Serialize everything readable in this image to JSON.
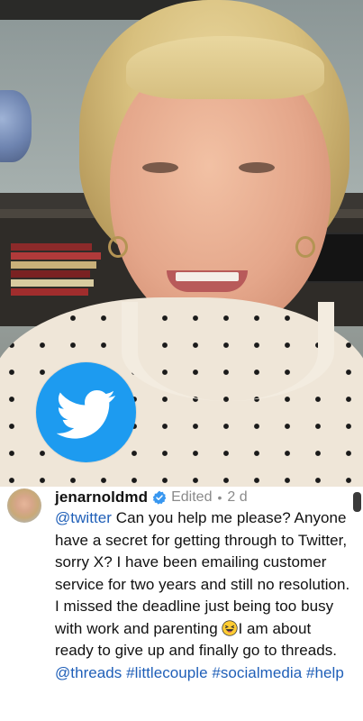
{
  "post": {
    "image_overlay_icon": "twitter-bird-icon",
    "brand_color": "#1d9bf0"
  },
  "comment": {
    "avatar_icon": "avatar",
    "username": "jenarnoldmd",
    "verified_icon": "verified-badge-icon",
    "edited_label": "Edited",
    "separator": "•",
    "age": "2 d",
    "mention_twitter": "@twitter",
    "text_1": " Can you help me please? Anyone have a secret for getting through to Twitter, sorry X? I have been emailing customer service for two years and still no resolution. I missed the deadline just being too busy with work and parenting ",
    "emoji_icon": "laughing-face-icon",
    "text_2": "I am about ready to give up and finally go to threads.",
    "mention_threads": "@threads",
    "hashtag_1": "#littlecouple",
    "hashtag_2": "#socialmedia",
    "hashtag_3": "#help",
    "link_color": "#1f5fb8"
  }
}
